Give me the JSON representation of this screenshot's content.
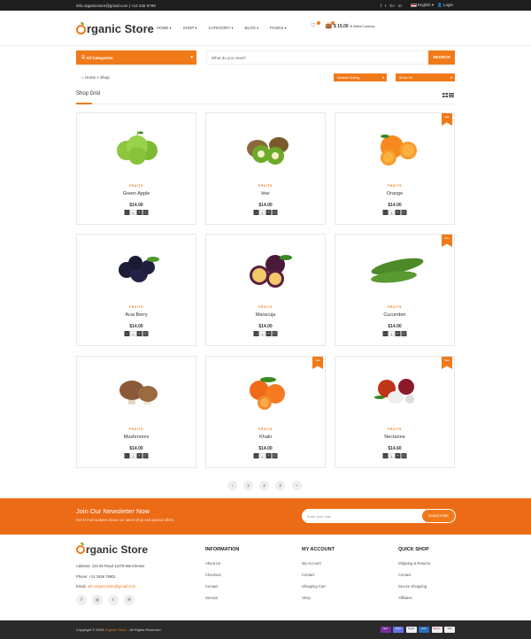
{
  "topbar": {
    "email": "info.organicstore@gmail.com",
    "sep": "|",
    "phone": "+12 345 6789",
    "social": [
      "f",
      "t",
      "G+",
      "in"
    ],
    "language": "English",
    "login": "Login"
  },
  "header": {
    "logo_letter": "O",
    "logo_text": "rganic Store",
    "nav": [
      "HOME",
      "SHOP",
      "CATEGORY",
      "BLOG",
      "PAGES"
    ],
    "cart_price": "$ 15.00",
    "cart_currency": "$ Select Currency"
  },
  "search": {
    "category_label": "All Categories",
    "placeholder": "What do you need?",
    "button": "SEARCH"
  },
  "breadcrumb": {
    "home": "Home",
    "sep": ">",
    "current": "Shop"
  },
  "sort": {
    "selected": "Default Sorting",
    "show": "Show 16"
  },
  "section_title": "Shop Grid",
  "products": [
    {
      "category": "FRUITS",
      "name": "Green Apple",
      "price": "$14.00",
      "sale": false,
      "img": "apple"
    },
    {
      "category": "FRUITS",
      "name": "kiwi",
      "price": "$14.00",
      "sale": false,
      "img": "kiwi"
    },
    {
      "category": "FRUITS",
      "name": "Orange",
      "price": "$14.00",
      "sale": true,
      "img": "orange"
    },
    {
      "category": "FRUITS",
      "name": "Acai Berry",
      "price": "$14.00",
      "sale": false,
      "img": "acai"
    },
    {
      "category": "FRUITS",
      "name": "Maracuja",
      "price": "$14.00",
      "sale": false,
      "img": "maracuja"
    },
    {
      "category": "FRUITS",
      "name": "Cucumber",
      "price": "$14.00",
      "sale": true,
      "img": "cucumber"
    },
    {
      "category": "FRUITS",
      "name": "Mushrooms",
      "price": "$14.00",
      "sale": false,
      "img": "mushroom"
    },
    {
      "category": "FRUITS",
      "name": "Khaki",
      "price": "$14.00",
      "sale": true,
      "img": "khaki"
    },
    {
      "category": "FRUITS",
      "name": "Nectarine",
      "price": "$14.60",
      "sale": true,
      "img": "nectarine"
    }
  ],
  "card_controls": {
    "minus": "-",
    "qty": "1",
    "plus": "+"
  },
  "sale_label": "Sale",
  "pagination": {
    "prev": "‹",
    "pages": [
      "1",
      "2",
      "3"
    ],
    "next": "›"
  },
  "newsletter": {
    "title": "Join Our Newsletter Now",
    "subtitle": "Get E-mail updates about our latest shop and special offers.",
    "placeholder": "Enter your mail",
    "button": "SUBSCRIBE"
  },
  "footer": {
    "logo_letter": "O",
    "logo_text": "rganic Store",
    "address": "Address: 123-45 Road 11378 Manchester",
    "phone": "Phone: +12 3456 78901",
    "email_label": "Email: ",
    "email": "info.organicstore@gmail.com",
    "social": [
      "f",
      "◎",
      "t",
      "℗"
    ],
    "columns": [
      {
        "title": "INFORMATION",
        "items": [
          "About Us",
          "Checkout",
          "Contact",
          "Servius"
        ]
      },
      {
        "title": "MY ACCOUNT",
        "items": [
          "My Account",
          "Contact",
          "Shopping Cart",
          "Shop"
        ]
      },
      {
        "title": "QUICK SHOP",
        "items": [
          "Shipping & Returns",
          "Contact",
          "Secure Shopping",
          "Affiliates"
        ]
      }
    ]
  },
  "copyright": {
    "pre": "Copyright © 2019 ",
    "brand": "Organic Store",
    "post": " - All Rights Reserved."
  },
  "payments": [
    "Skrill",
    "Stripe",
    "PayPal",
    "Amex",
    "Maestro",
    "VISA"
  ]
}
